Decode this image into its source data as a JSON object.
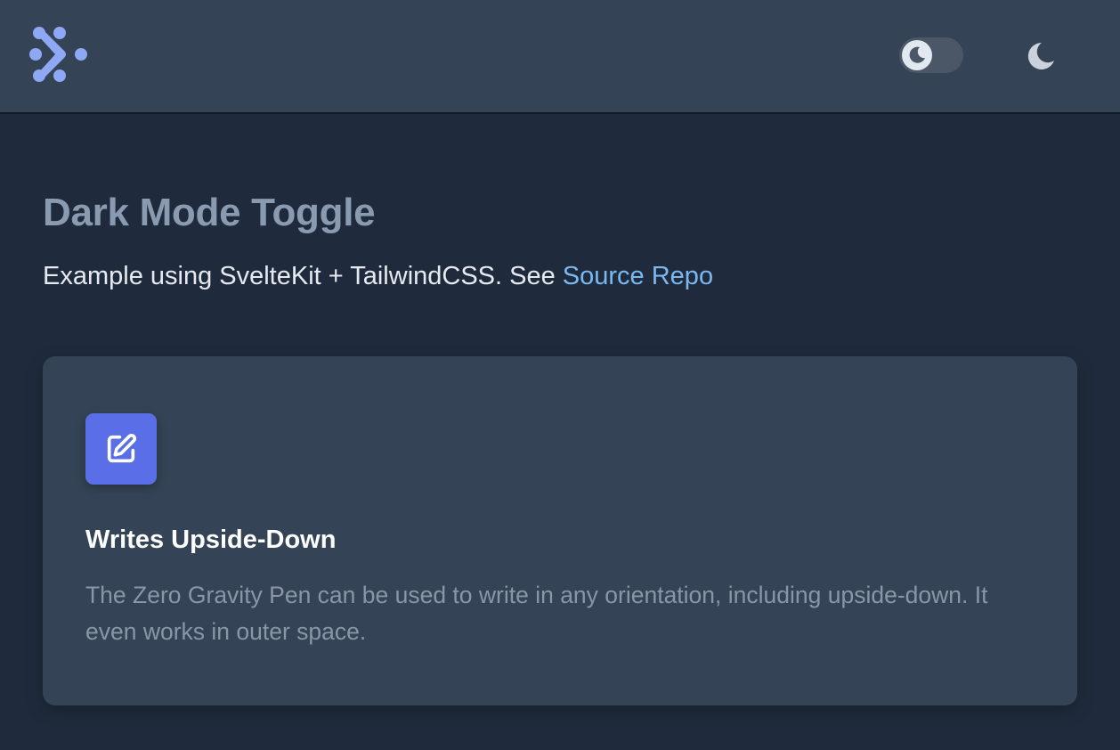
{
  "header": {
    "logo_icon": "svelte-dots-logo-icon",
    "toggle_icon": "moon-icon",
    "theme_button_icon": "moon-icon",
    "colors": {
      "background": "#344355",
      "logo": "#8fa8f5"
    }
  },
  "main": {
    "title": "Dark Mode Toggle",
    "subtitle_text": "Example using SvelteKit + TailwindCSS. See ",
    "subtitle_link": "Source Repo"
  },
  "card": {
    "icon": "pencil-square-icon",
    "icon_color": "#5a6ee8",
    "title": "Writes Upside-Down",
    "text": "The Zero Gravity Pen can be used to write in any orientation, including upside-down. It even works in outer space."
  }
}
